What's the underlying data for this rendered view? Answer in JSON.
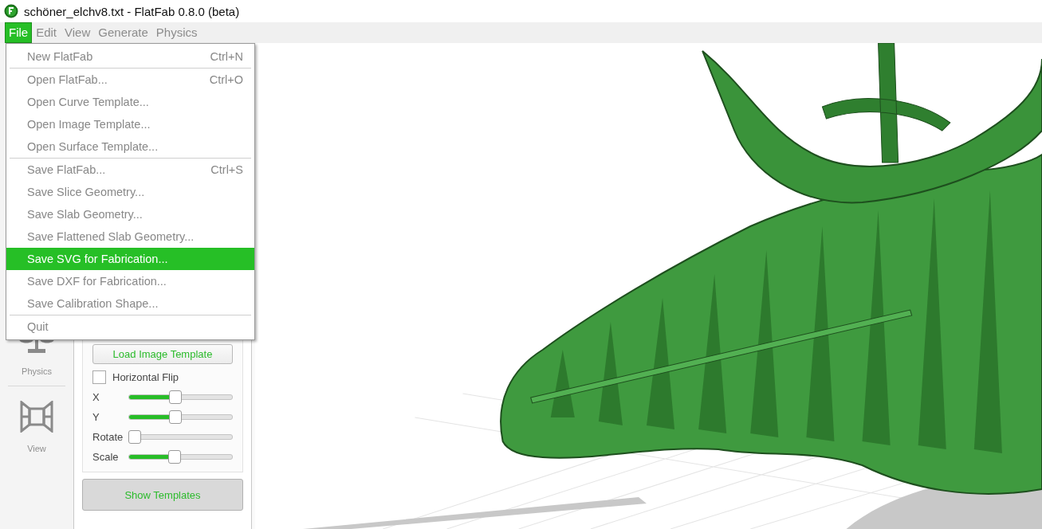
{
  "window": {
    "title": "schöner_elchv8.txt - FlatFab 0.8.0 (beta)"
  },
  "menubar": [
    {
      "label": "File",
      "selected": true
    },
    {
      "label": "Edit",
      "selected": false
    },
    {
      "label": "View",
      "selected": false
    },
    {
      "label": "Generate",
      "selected": false
    },
    {
      "label": "Physics",
      "selected": false
    }
  ],
  "file_menu": [
    {
      "kind": "item",
      "label": "New FlatFab",
      "shortcut": "Ctrl+N",
      "selected": false
    },
    {
      "kind": "separator"
    },
    {
      "kind": "item",
      "label": "Open FlatFab...",
      "shortcut": "Ctrl+O",
      "selected": false
    },
    {
      "kind": "item",
      "label": "Open Curve Template...",
      "selected": false
    },
    {
      "kind": "item",
      "label": "Open Image Template...",
      "selected": false
    },
    {
      "kind": "item",
      "label": "Open Surface Template...",
      "selected": false
    },
    {
      "kind": "separator"
    },
    {
      "kind": "item",
      "label": "Save FlatFab...",
      "shortcut": "Ctrl+S",
      "selected": false
    },
    {
      "kind": "item",
      "label": "Save Slice Geometry...",
      "selected": false
    },
    {
      "kind": "item",
      "label": "Save Slab Geometry...",
      "selected": false
    },
    {
      "kind": "item",
      "label": "Save Flattened Slab Geometry...",
      "selected": false
    },
    {
      "kind": "item",
      "label": "Save SVG for Fabrication...",
      "selected": true
    },
    {
      "kind": "item",
      "label": "Save DXF for Fabrication...",
      "selected": false
    },
    {
      "kind": "item",
      "label": "Save Calibration Shape...",
      "selected": false
    },
    {
      "kind": "separator"
    },
    {
      "kind": "item",
      "label": "Quit",
      "selected": false
    }
  ],
  "toolbar": [
    {
      "kind": "physics",
      "label": "Physics"
    },
    {
      "kind": "view",
      "label": "View"
    }
  ],
  "template_panel": {
    "load_button": "Load Image Template",
    "horizontal_flip": {
      "label": "Horizontal Flip",
      "checked": false
    },
    "sliders": [
      {
        "label": "X",
        "level": 0.45
      },
      {
        "label": "Y",
        "level": 0.45
      },
      {
        "label": "Rotate",
        "level": 0.0
      },
      {
        "label": "Scale",
        "level": 0.44
      }
    ],
    "show_button": "Show Templates"
  }
}
